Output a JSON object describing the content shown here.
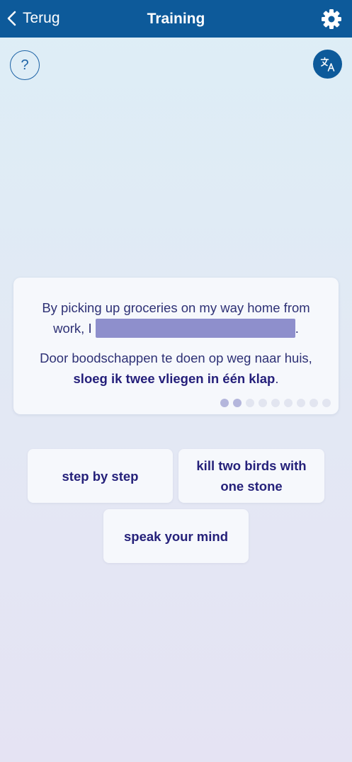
{
  "header": {
    "back_label": "Terug",
    "title": "Training",
    "icons": {
      "back": "chevron-left-icon",
      "settings": "gear-icon"
    }
  },
  "toolbar": {
    "help_label": "?",
    "translate_icon": "translate-icon"
  },
  "card": {
    "sentence_en_before": "By picking up groceries on my way home from work, I",
    "sentence_en_after": ".",
    "sentence_nl_plain": "Door boodschappen te doen op weg naar huis,",
    "sentence_nl_bold": "sloeg ik twee vliegen in één klap",
    "sentence_nl_end": ".",
    "progress": {
      "total": 9,
      "completed": 2
    }
  },
  "options": [
    {
      "label": "step by step"
    },
    {
      "label": "kill two birds with one stone"
    },
    {
      "label": "speak your mind"
    }
  ],
  "colors": {
    "header_bg": "#0d5a9a",
    "blank": "#8e8fcc",
    "text": "#25217a"
  }
}
